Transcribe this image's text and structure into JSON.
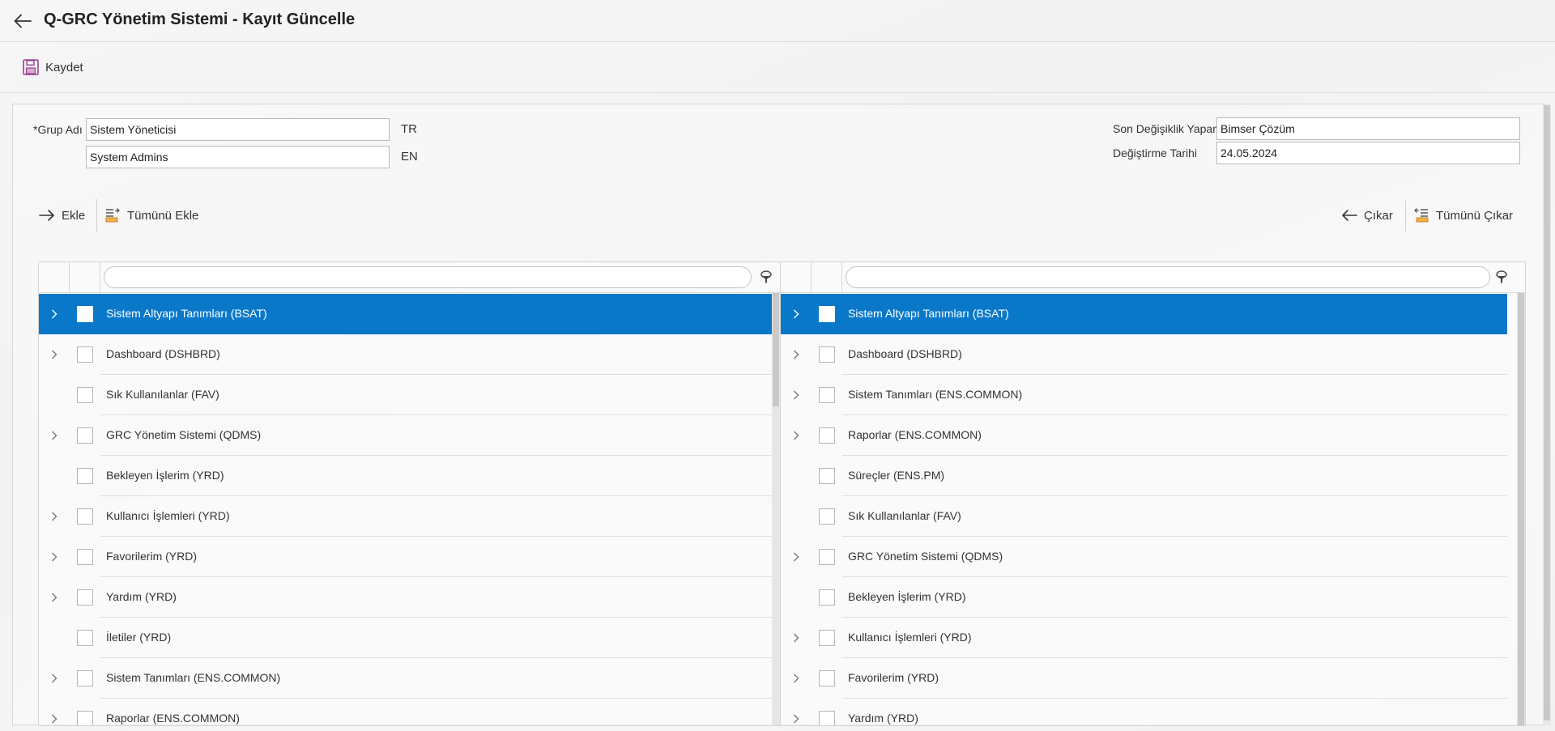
{
  "header": {
    "title": "Q-GRC Yönetim Sistemi - Kayıt Güncelle",
    "back_icon": "arrow-left-icon"
  },
  "toolbar": {
    "save_label": "Kaydet",
    "save_icon": "floppy-disk-icon"
  },
  "form": {
    "group_name_label": "*Grup Adı",
    "group_name_tr": "Sistem Yöneticisi",
    "group_name_en": "System Admins",
    "lang_tr": "TR",
    "lang_en": "EN",
    "last_modified_by_label": "Son Değişiklik Yapan",
    "last_modified_by": "Bimser Çözüm",
    "modified_date_label": "Değiştirme Tarihi",
    "modified_date": "24.05.2024"
  },
  "actions": {
    "add_label": "Ekle",
    "add_all_label": "Tümünü Ekle",
    "remove_label": "Çıkar",
    "remove_all_label": "Tümünü Çıkar"
  },
  "left_list": {
    "filter_value": "",
    "items": [
      {
        "label": "Sistem Altyapı Tanımları (BSAT)",
        "expandable": true,
        "selected": true
      },
      {
        "label": "Dashboard (DSHBRD)",
        "expandable": true,
        "selected": false
      },
      {
        "label": "Sık Kullanılanlar (FAV)",
        "expandable": false,
        "selected": false
      },
      {
        "label": "GRC Yönetim Sistemi (QDMS)",
        "expandable": true,
        "selected": false
      },
      {
        "label": "Bekleyen İşlerim (YRD)",
        "expandable": false,
        "selected": false
      },
      {
        "label": "Kullanıcı İşlemleri (YRD)",
        "expandable": true,
        "selected": false
      },
      {
        "label": "Favorilerim (YRD)",
        "expandable": true,
        "selected": false
      },
      {
        "label": "Yardım (YRD)",
        "expandable": true,
        "selected": false
      },
      {
        "label": "İletiler (YRD)",
        "expandable": false,
        "selected": false
      },
      {
        "label": "Sistem Tanımları (ENS.COMMON)",
        "expandable": true,
        "selected": false
      },
      {
        "label": "Raporlar (ENS.COMMON)",
        "expandable": true,
        "selected": false
      }
    ]
  },
  "right_list": {
    "filter_value": "",
    "items": [
      {
        "label": "Sistem Altyapı Tanımları (BSAT)",
        "expandable": true,
        "selected": true
      },
      {
        "label": "Dashboard (DSHBRD)",
        "expandable": true,
        "selected": false
      },
      {
        "label": "Sistem Tanımları (ENS.COMMON)",
        "expandable": true,
        "selected": false
      },
      {
        "label": "Raporlar (ENS.COMMON)",
        "expandable": true,
        "selected": false
      },
      {
        "label": "Süreçler (ENS.PM)",
        "expandable": false,
        "selected": false
      },
      {
        "label": "Sık Kullanılanlar (FAV)",
        "expandable": false,
        "selected": false
      },
      {
        "label": "GRC Yönetim Sistemi (QDMS)",
        "expandable": true,
        "selected": false
      },
      {
        "label": "Bekleyen İşlerim (YRD)",
        "expandable": false,
        "selected": false
      },
      {
        "label": "Kullanıcı İşlemleri (YRD)",
        "expandable": true,
        "selected": false
      },
      {
        "label": "Favorilerim (YRD)",
        "expandable": true,
        "selected": false
      },
      {
        "label": "Yardım (YRD)",
        "expandable": true,
        "selected": false
      }
    ]
  },
  "colors": {
    "selection": "#0a78c9",
    "save_icon": "#9b3f8f"
  }
}
